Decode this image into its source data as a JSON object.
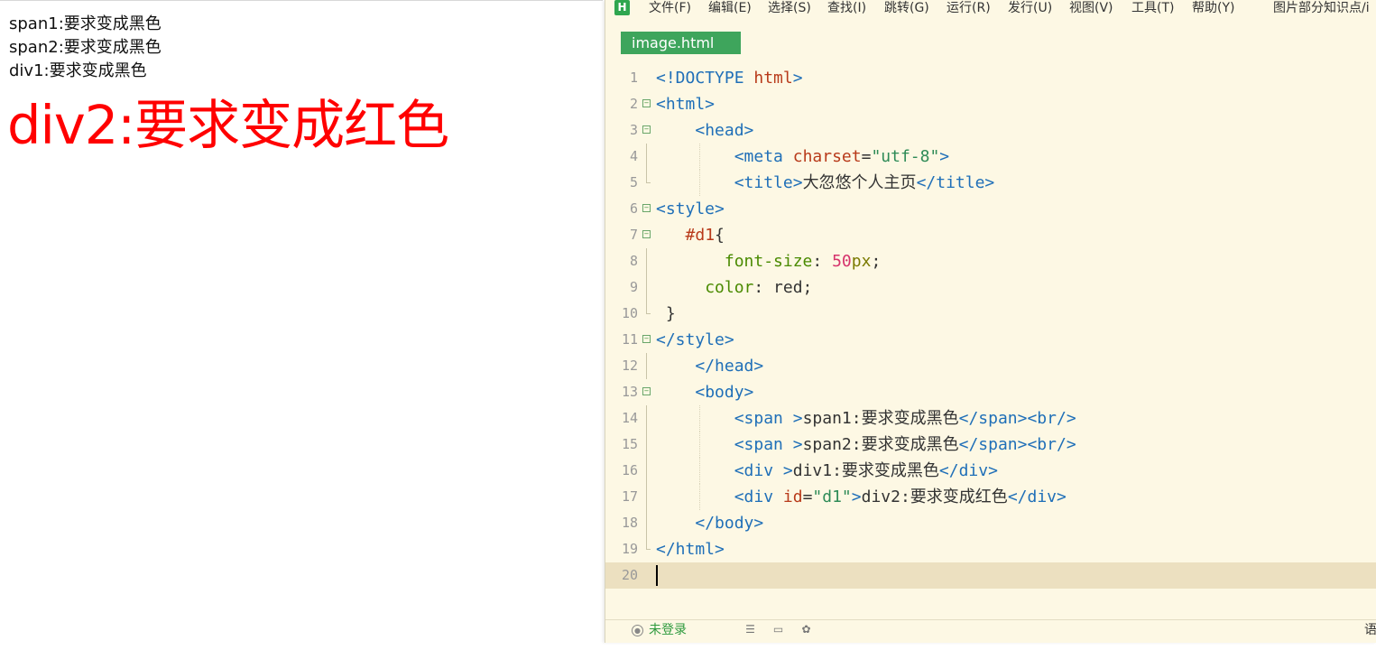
{
  "preview": {
    "lines": [
      "span1:要求变成黑色",
      "span2:要求变成黑色",
      "div1:要求变成黑色"
    ],
    "div2": "div2:要求变成红色"
  },
  "menu": {
    "logo": "H",
    "items": [
      "文件(F)",
      "编辑(E)",
      "选择(S)",
      "查找(I)",
      "跳转(G)",
      "运行(R)",
      "发行(U)",
      "视图(V)",
      "工具(T)",
      "帮助(Y)",
      "图片部分知识点/i"
    ]
  },
  "tab": {
    "active": "image.html"
  },
  "code": {
    "lines": [
      [
        [
          "t-tag",
          "<!DOCTYPE "
        ],
        [
          "t-name",
          "html"
        ],
        [
          "t-tag",
          ">"
        ]
      ],
      [
        [
          "t-tag",
          "<html>"
        ]
      ],
      [
        [
          "t-plain",
          "    "
        ],
        [
          "t-tag",
          "<head>"
        ]
      ],
      [
        [
          "t-plain",
          "        "
        ],
        [
          "t-tag",
          "<meta "
        ],
        [
          "t-attr",
          "charset"
        ],
        [
          "t-plain",
          "="
        ],
        [
          "t-str",
          "\"utf-8\""
        ],
        [
          "t-tag",
          ">"
        ]
      ],
      [
        [
          "t-plain",
          "        "
        ],
        [
          "t-tag",
          "<title>"
        ],
        [
          "t-text",
          "大忽悠个人主页"
        ],
        [
          "t-tag",
          "</title>"
        ]
      ],
      [
        [
          "t-tag",
          "<style>"
        ]
      ],
      [
        [
          "t-plain",
          "   "
        ],
        [
          "t-name",
          "#d1"
        ],
        [
          "t-plain",
          "{"
        ]
      ],
      [
        [
          "t-plain",
          "       "
        ],
        [
          "t-prop",
          "font-size"
        ],
        [
          "t-plain",
          ": "
        ],
        [
          "t-num",
          "50"
        ],
        [
          "t-unit",
          "px"
        ],
        [
          "t-plain",
          ";"
        ]
      ],
      [
        [
          "t-plain",
          "     "
        ],
        [
          "t-prop",
          "color"
        ],
        [
          "t-plain",
          ": red;"
        ]
      ],
      [
        [
          "t-plain",
          " }"
        ]
      ],
      [
        [
          "t-tag",
          "</style>"
        ]
      ],
      [
        [
          "t-plain",
          "    "
        ],
        [
          "t-tag",
          "</head>"
        ]
      ],
      [
        [
          "t-plain",
          "    "
        ],
        [
          "t-tag",
          "<body>"
        ]
      ],
      [
        [
          "t-plain",
          "        "
        ],
        [
          "t-tag",
          "<span "
        ],
        [
          "t-tag",
          ">"
        ],
        [
          "t-text",
          "span1:要求变成黑色"
        ],
        [
          "t-tag",
          "</span><br/>"
        ]
      ],
      [
        [
          "t-plain",
          "        "
        ],
        [
          "t-tag",
          "<span "
        ],
        [
          "t-tag",
          ">"
        ],
        [
          "t-text",
          "span2:要求变成黑色"
        ],
        [
          "t-tag",
          "</span><br/>"
        ]
      ],
      [
        [
          "t-plain",
          "        "
        ],
        [
          "t-tag",
          "<div "
        ],
        [
          "t-tag",
          ">"
        ],
        [
          "t-text",
          "div1:要求变成黑色"
        ],
        [
          "t-tag",
          "</div>"
        ]
      ],
      [
        [
          "t-plain",
          "        "
        ],
        [
          "t-tag",
          "<div "
        ],
        [
          "t-attr",
          "id"
        ],
        [
          "t-plain",
          "="
        ],
        [
          "t-str",
          "\"d1\""
        ],
        [
          "t-tag",
          ">"
        ],
        [
          "t-text",
          "div2:要求变成红色"
        ],
        [
          "t-tag",
          "</div>"
        ]
      ],
      [
        [
          "t-plain",
          "    "
        ],
        [
          "t-tag",
          "</body>"
        ]
      ],
      [
        [
          "t-tag",
          "</html>"
        ]
      ],
      []
    ],
    "line_numbers": [
      "1",
      "2",
      "3",
      "4",
      "5",
      "6",
      "7",
      "8",
      "9",
      "10",
      "11",
      "12",
      "13",
      "14",
      "15",
      "16",
      "17",
      "18",
      "19",
      "20"
    ]
  },
  "status": {
    "login": "未登录",
    "lang": "语",
    "icons": [
      "list-icon",
      "terminal-icon",
      "palette-icon"
    ]
  }
}
